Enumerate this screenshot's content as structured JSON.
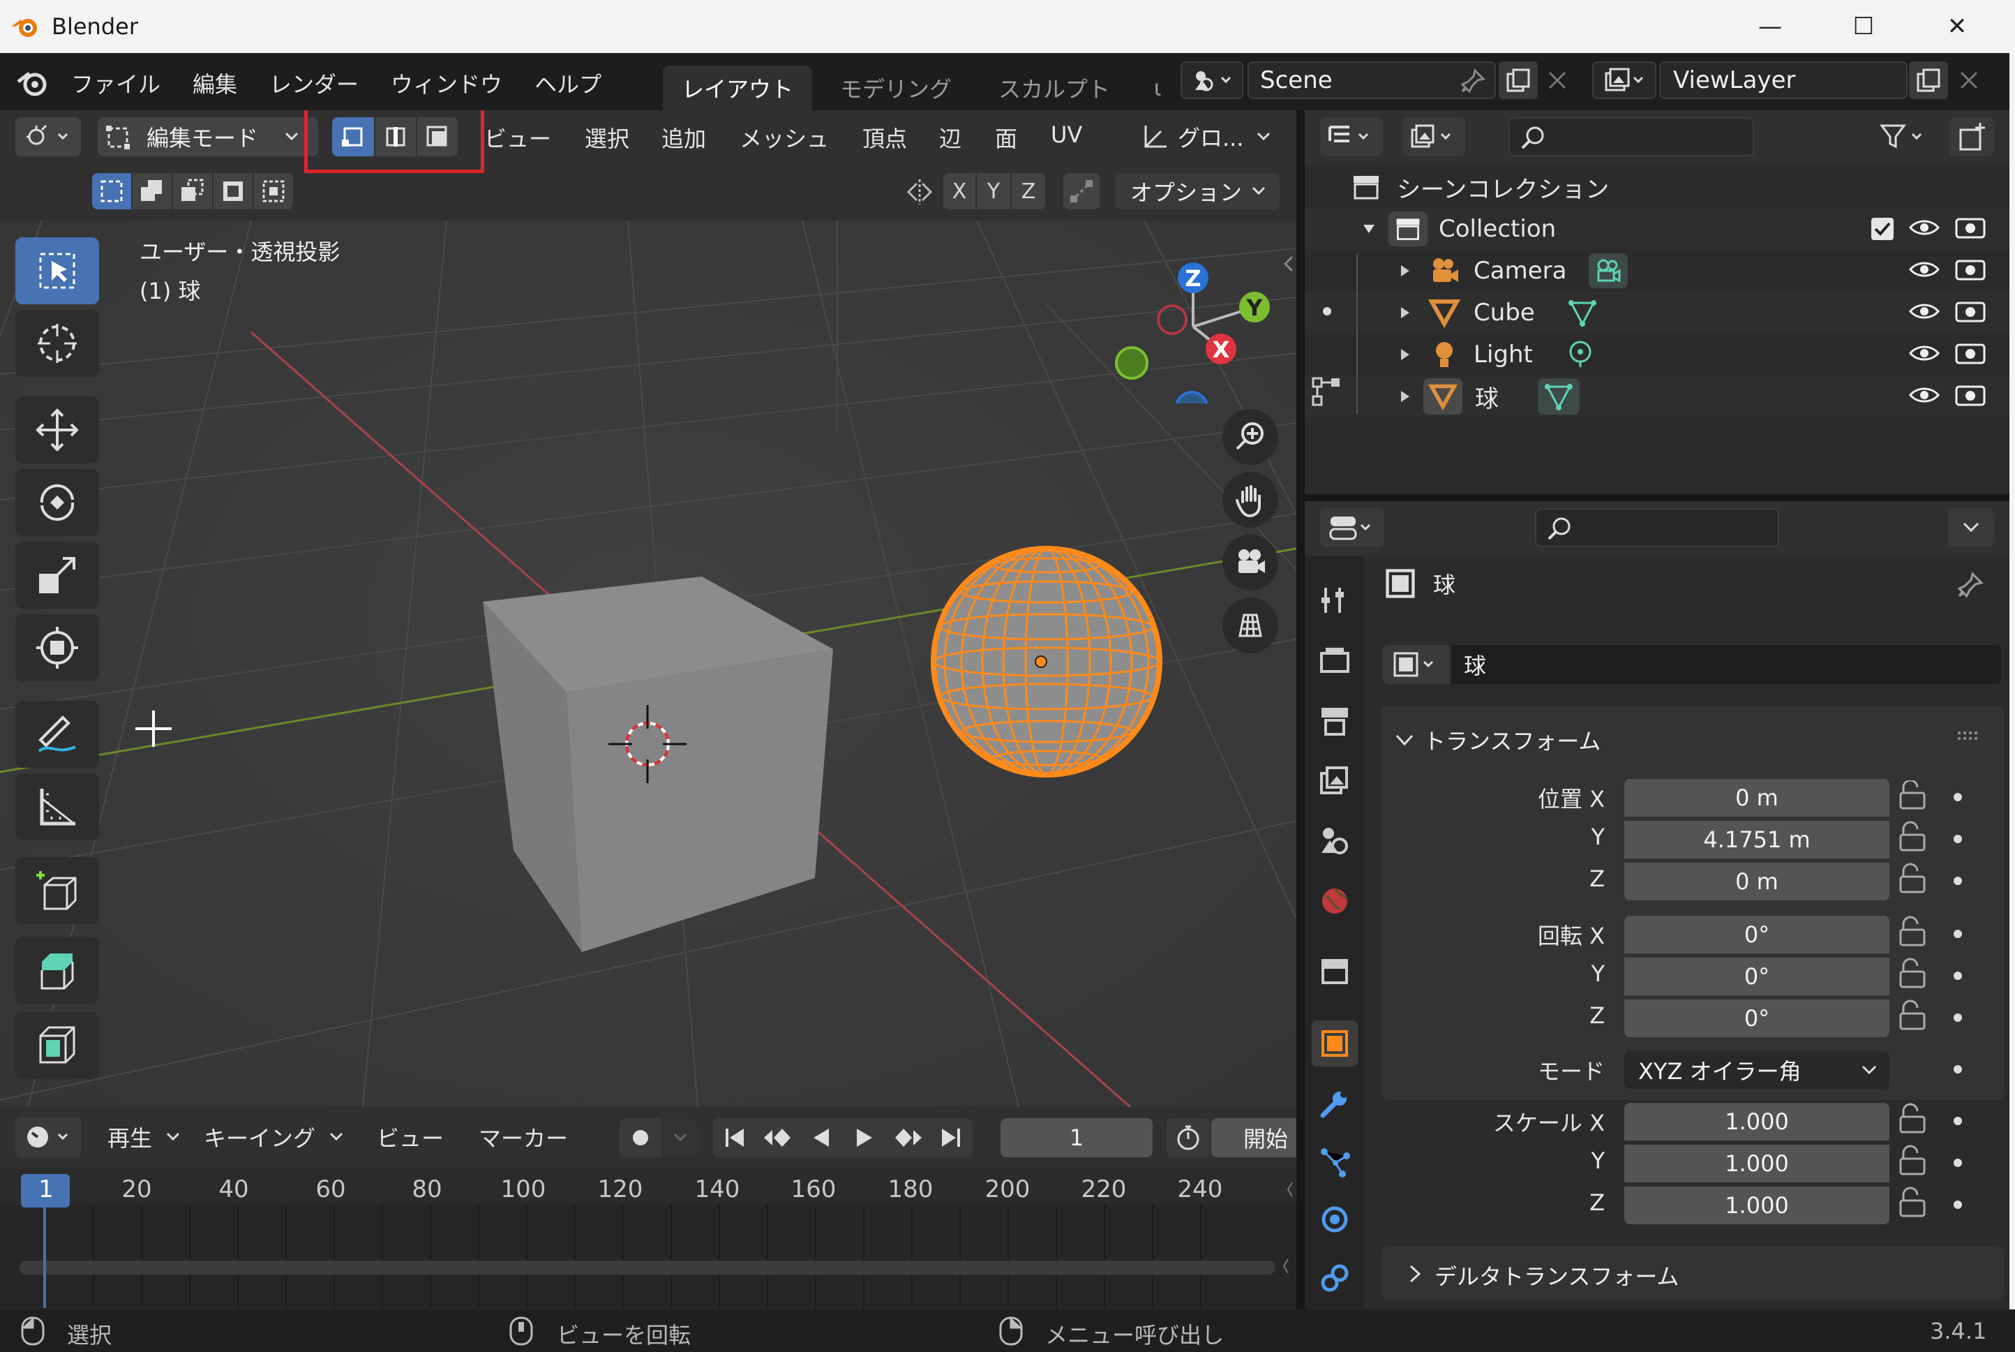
{
  "window": {
    "title": "Blender",
    "minimize": "—",
    "maximize": "☐",
    "close": "✕"
  },
  "topbar": {
    "menus": [
      "ファイル",
      "編集",
      "レンダー",
      "ウィンドウ",
      "ヘルプ"
    ],
    "workspaces": [
      "レイアウト",
      "モデリング",
      "スカルプト",
      "ι"
    ],
    "scene": "Scene",
    "view_layer": "ViewLayer"
  },
  "viewport": {
    "mode": "編集モード",
    "menus": [
      "ビュー",
      "選択",
      "追加",
      "メッシュ",
      "頂点",
      "辺",
      "面",
      "UV"
    ],
    "transform_orientation": "グロ...",
    "axes": [
      "X",
      "Y",
      "Z"
    ],
    "options": "オプション",
    "overlay_view": "ユーザー・透視投影",
    "overlay_object": "(1) 球",
    "gizmo": {
      "x": "X",
      "y": "Y",
      "z": "Z"
    }
  },
  "timeline": {
    "menus": [
      "再生",
      "キーイング",
      "ビュー",
      "マーカー"
    ],
    "current_frame": "1",
    "start_label": "開始",
    "ticks": [
      "1",
      "20",
      "40",
      "60",
      "80",
      "100",
      "120",
      "140",
      "160",
      "180",
      "200",
      "220",
      "240"
    ]
  },
  "status": {
    "left": "選択",
    "middle": "ビューを回転",
    "right": "メニュー呼び出し",
    "version": "3.4.1"
  },
  "outliner": {
    "root": "シーンコレクション",
    "collection": "Collection",
    "items": [
      "Camera",
      "Cube",
      "Light",
      "球"
    ]
  },
  "properties": {
    "object_name": "球",
    "mesh_name": "球",
    "panel_title": "トランスフォーム",
    "location_label": "位置 X",
    "rotation_label": "回転 X",
    "scale_label": "スケール X",
    "y_label": "Y",
    "z_label": "Z",
    "location": [
      "0 m",
      "4.1751 m",
      "0 m"
    ],
    "rotation": [
      "0°",
      "0°",
      "0°"
    ],
    "mode_label": "モード",
    "mode_value": "XYZ オイラー角",
    "scale": [
      "1.000",
      "1.000",
      "1.000"
    ],
    "delta_panel": "デルタトランスフォーム"
  },
  "colors": {
    "accent": "#4772b3",
    "selection": "#ff8a1a",
    "highlight_box": "#e0242c"
  }
}
